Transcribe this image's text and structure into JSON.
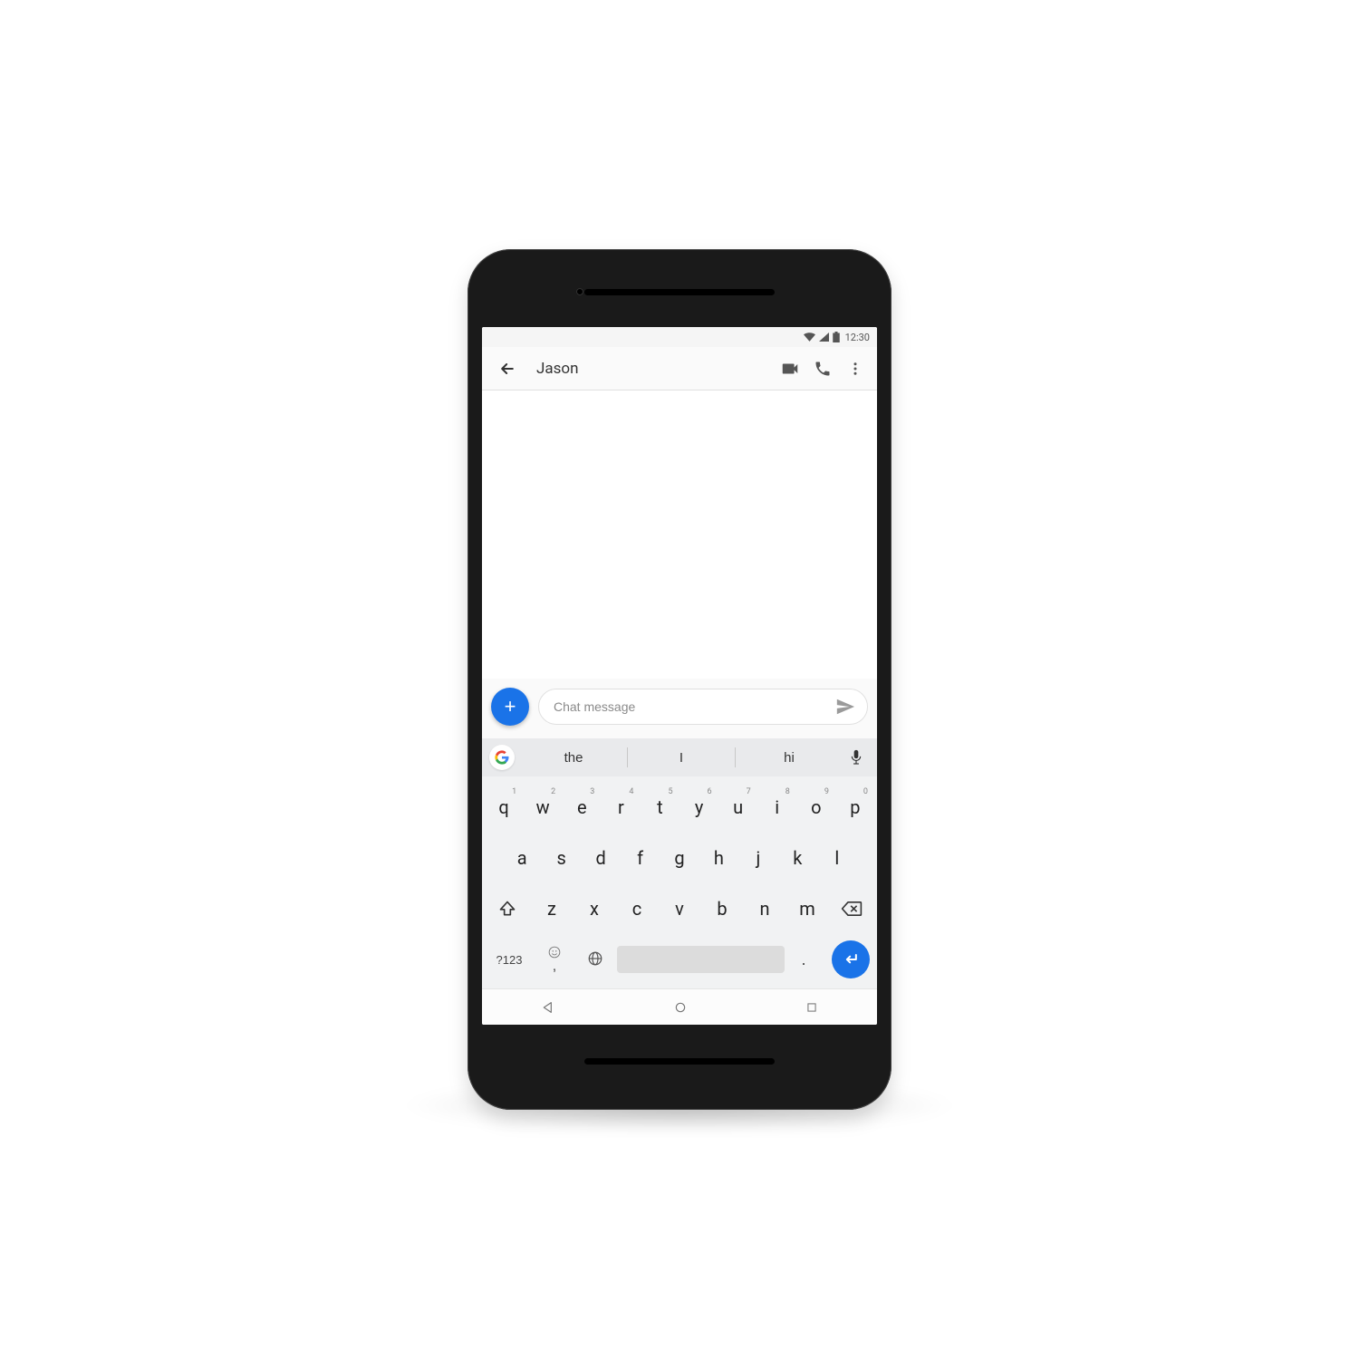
{
  "status": {
    "time": "12:30"
  },
  "appbar": {
    "title": "Jason"
  },
  "compose": {
    "placeholder": "Chat message"
  },
  "suggestions": [
    "the",
    "I",
    "hi"
  ],
  "keyboard": {
    "row1": [
      {
        "k": "q",
        "n": "1"
      },
      {
        "k": "w",
        "n": "2"
      },
      {
        "k": "e",
        "n": "3"
      },
      {
        "k": "r",
        "n": "4"
      },
      {
        "k": "t",
        "n": "5"
      },
      {
        "k": "y",
        "n": "6"
      },
      {
        "k": "u",
        "n": "7"
      },
      {
        "k": "i",
        "n": "8"
      },
      {
        "k": "o",
        "n": "9"
      },
      {
        "k": "p",
        "n": "0"
      }
    ],
    "row2": [
      "a",
      "s",
      "d",
      "f",
      "g",
      "h",
      "j",
      "k",
      "l"
    ],
    "row3": [
      "z",
      "x",
      "c",
      "v",
      "b",
      "n",
      "m"
    ],
    "sym_label": "?123",
    "comma": ",",
    "period": "."
  }
}
